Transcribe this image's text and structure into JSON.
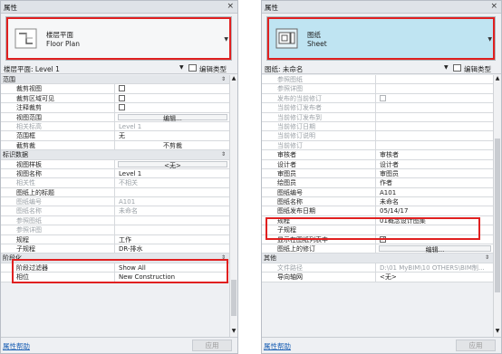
{
  "left": {
    "title": "属性",
    "close": "×",
    "selector": {
      "name_cn": "楼层平面",
      "name_en": "Floor Plan"
    },
    "type_label": "楼层平面: Level 1",
    "edit_type": "编辑类型",
    "rows": [
      {
        "kind": "group",
        "label": "范围",
        "control": "⇕"
      },
      {
        "label": "裁剪视图",
        "check": "unchecked"
      },
      {
        "label": "裁剪区域可见",
        "check": "unchecked"
      },
      {
        "label": "注释裁剪",
        "check": "unchecked"
      },
      {
        "label": "视图范围",
        "button": "编辑..."
      },
      {
        "label": "相关标高",
        "value": "Level 1",
        "gray": true
      },
      {
        "label": "范围框",
        "value": "无"
      },
      {
        "label": "截剪裁",
        "button": "不剪裁",
        "flat": true
      },
      {
        "kind": "group",
        "label": "标识数据",
        "control": "⇕"
      },
      {
        "label": "视图样板",
        "button": "<无>"
      },
      {
        "label": "视图名称",
        "value": "Level 1"
      },
      {
        "label": "相关性",
        "value": "不相关",
        "gray": true
      },
      {
        "label": "图纸上的标题",
        "value": ""
      },
      {
        "label": "图纸编号",
        "value": "A101",
        "gray": true
      },
      {
        "label": "图纸名称",
        "value": "未命名",
        "gray": true
      },
      {
        "label": "参照图纸",
        "value": "",
        "gray": true
      },
      {
        "label": "参照详图",
        "value": "",
        "gray": true
      },
      {
        "label": "规程",
        "value": "工作"
      },
      {
        "label": "子规程",
        "value": "DR-排水"
      },
      {
        "kind": "group",
        "label": "阶段化",
        "control": "⇕"
      },
      {
        "label": "阶段过滤器",
        "value": "Show All"
      },
      {
        "label": "相位",
        "value": "New Construction"
      }
    ],
    "help": "属性帮助",
    "apply": "应用"
  },
  "right": {
    "title": "属性",
    "close": "×",
    "selector": {
      "name_cn": "图纸",
      "name_en": "Sheet"
    },
    "type_label": "图纸: 未命名",
    "edit_type": "编辑类型",
    "rows": [
      {
        "label": "参照图纸",
        "value": "",
        "gray": true
      },
      {
        "label": "参照详图",
        "value": "",
        "gray": true
      },
      {
        "label": "发布的当前修订",
        "check": "gray",
        "gray": true
      },
      {
        "label": "当前修订发布者",
        "value": "",
        "gray": true
      },
      {
        "label": "当前修订发布到",
        "value": "",
        "gray": true
      },
      {
        "label": "当前修订日期",
        "value": "",
        "gray": true
      },
      {
        "label": "当前修订说明",
        "value": "",
        "gray": true
      },
      {
        "label": "当前修订",
        "value": "",
        "gray": true
      },
      {
        "label": "审核者",
        "value": "审核者"
      },
      {
        "label": "设计者",
        "value": "设计者"
      },
      {
        "label": "审图员",
        "value": "审图员"
      },
      {
        "label": "绘图员",
        "value": "作者"
      },
      {
        "label": "图纸编号",
        "value": "A101"
      },
      {
        "label": "图纸名称",
        "value": "未命名"
      },
      {
        "label": "图纸发布日期",
        "value": "05/14/17"
      },
      {
        "label": "规程",
        "value": "01概念设计图集"
      },
      {
        "label": "子规程",
        "value": ""
      },
      {
        "label": "显示在图纸列表中",
        "check": "checked"
      },
      {
        "label": "图纸上的修订",
        "button": "编辑..."
      },
      {
        "kind": "group",
        "label": "其他",
        "control": "⇕"
      },
      {
        "label": "文件路径",
        "value": "D:\\01 MyBIM\\10 OTHERS\\BIM制...",
        "gray": true
      },
      {
        "label": "导向轴网",
        "value": "<无>"
      }
    ],
    "help": "属性帮助",
    "apply": "应用"
  }
}
